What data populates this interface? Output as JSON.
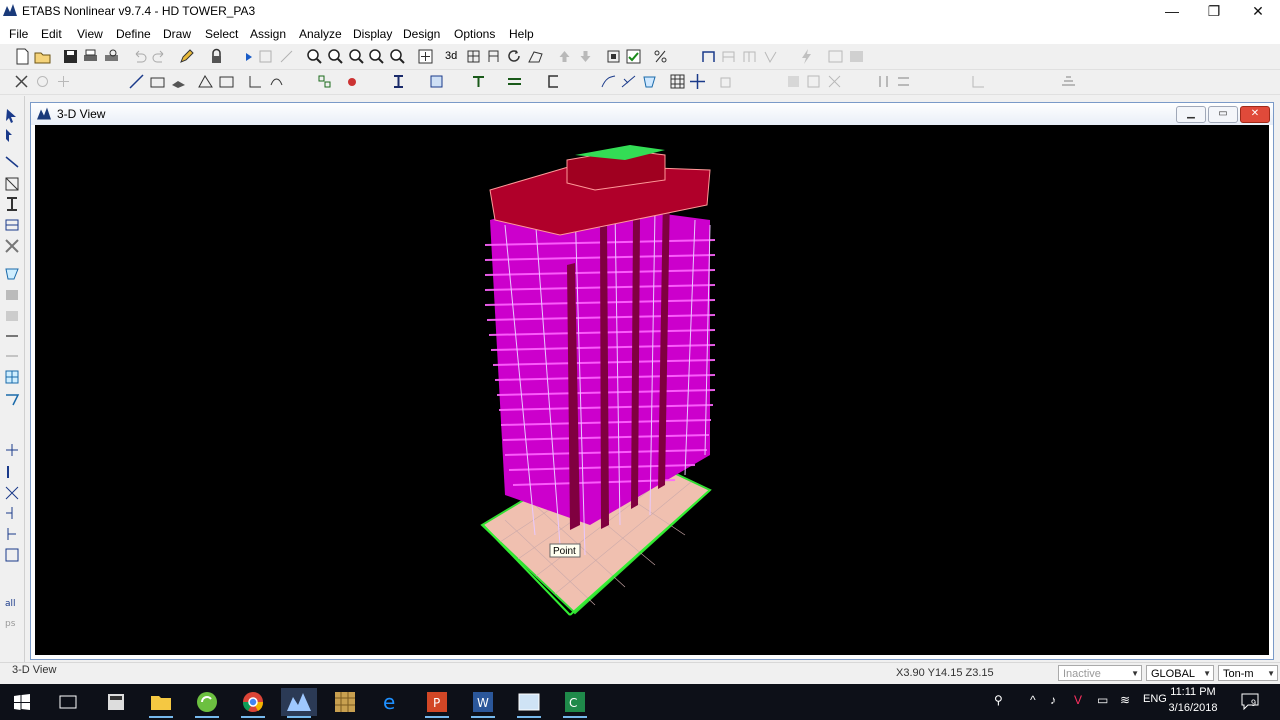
{
  "window": {
    "title": "ETABS Nonlinear v9.7.4 - HD TOWER_PA3",
    "minimize": "—",
    "maximize": "❐",
    "close": "✕"
  },
  "menu": [
    "File",
    "Edit",
    "View",
    "Define",
    "Draw",
    "Select",
    "Assign",
    "Analyze",
    "Display",
    "Design",
    "Options",
    "Help"
  ],
  "toolbar1": {
    "view_3d_label": "3d",
    "icons": [
      "new-model-icon",
      "open-icon",
      "save-icon",
      "print-icon",
      "print-preview-icon",
      "undo-icon",
      "redo-icon",
      "edit-pencil-icon",
      "lock-icon",
      "run-analysis-icon",
      "zoom-window-icon",
      "zoom-in-icon",
      "zoom-out-icon",
      "pan-icon",
      "restore-view-icon",
      "3d-view-icon",
      "plan-view-icon",
      "elevation-view-icon",
      "rotate-view-icon",
      "perspective-icon",
      "move-up-icon",
      "move-down-icon",
      "object-shrink-icon",
      "set-display-options-icon",
      "percent-icon",
      "frame-icon",
      "design-icon"
    ]
  },
  "toolbar2": {
    "icons": [
      "pointer-icon",
      "reshape-icon",
      "draw-frame-icon",
      "draw-area-icon",
      "draw-wall-icon",
      "assign-restraints-icon",
      "assign-loads-icon",
      "section-icon",
      "display-icon",
      "deformed-shape-icon",
      "grid-icon"
    ]
  },
  "child_window": {
    "title": "3-D View",
    "point_label": "Point"
  },
  "status": {
    "view_name": "3-D View",
    "coords": "X3.90  Y14.15  Z3.15",
    "mode": "Inactive",
    "coord_system": "GLOBAL",
    "units": "Ton-m"
  },
  "taskbar": {
    "apps": [
      "start-icon",
      "task-view-icon",
      "calculator-icon",
      "file-explorer-icon",
      "sync-icon",
      "chrome-icon",
      "etabs-icon",
      "archicad-icon",
      "edge-icon",
      "powerpoint-icon",
      "word-icon",
      "window-icon",
      "green-app-icon"
    ],
    "lang": "ENG",
    "time": "11:11 PM",
    "date": "3/16/2018",
    "notification_count": "9"
  },
  "colors": {
    "viewport_bg": "#000000",
    "building_slab": "#d000d0",
    "frame_lines": "#e8c8ff",
    "podium": "#f0c0a0",
    "ground_grid": "#33dd33"
  }
}
